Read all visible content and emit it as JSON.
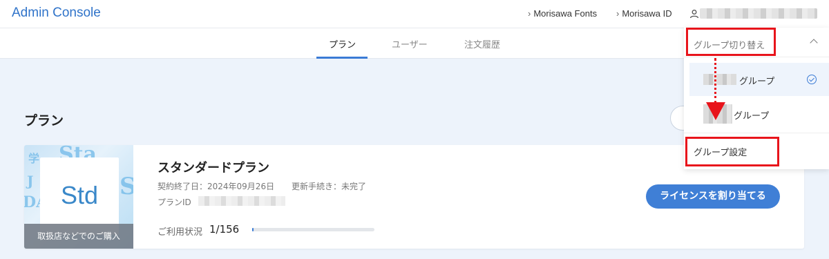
{
  "header": {
    "brand": "Admin Console",
    "links": [
      {
        "label": "Morisawa Fonts"
      },
      {
        "label": "Morisawa ID"
      }
    ]
  },
  "tabs": [
    {
      "label": "プラン",
      "active": true
    },
    {
      "label": "ユーザー",
      "active": false
    },
    {
      "label": "注文履歴",
      "active": false
    }
  ],
  "main": {
    "section_title": "プラン",
    "plan": {
      "thumb_text": "Std",
      "thumb_strip": "取扱店などでのご購入",
      "name": "スタンダードプラン",
      "contract_end": "契約終了日：2024年09月26日",
      "renewal": "更新手続き：未完了",
      "plan_id_label": "プランID",
      "usage_label": "ご利用状況",
      "usage_value": "1/156",
      "usage_fraction": 0.0064,
      "assign_button": "ライセンスを割り当てる"
    }
  },
  "dropdown": {
    "title": "グループ切り替え",
    "groups": [
      {
        "label": "グループ",
        "selected": true
      },
      {
        "label": "グループ",
        "selected": false
      }
    ],
    "settings": "グループ設定"
  },
  "colors": {
    "accent": "#3a7bd5",
    "brand": "#2f73c9",
    "annotation": "#e8141b",
    "page_bg": "#edf3fb"
  }
}
